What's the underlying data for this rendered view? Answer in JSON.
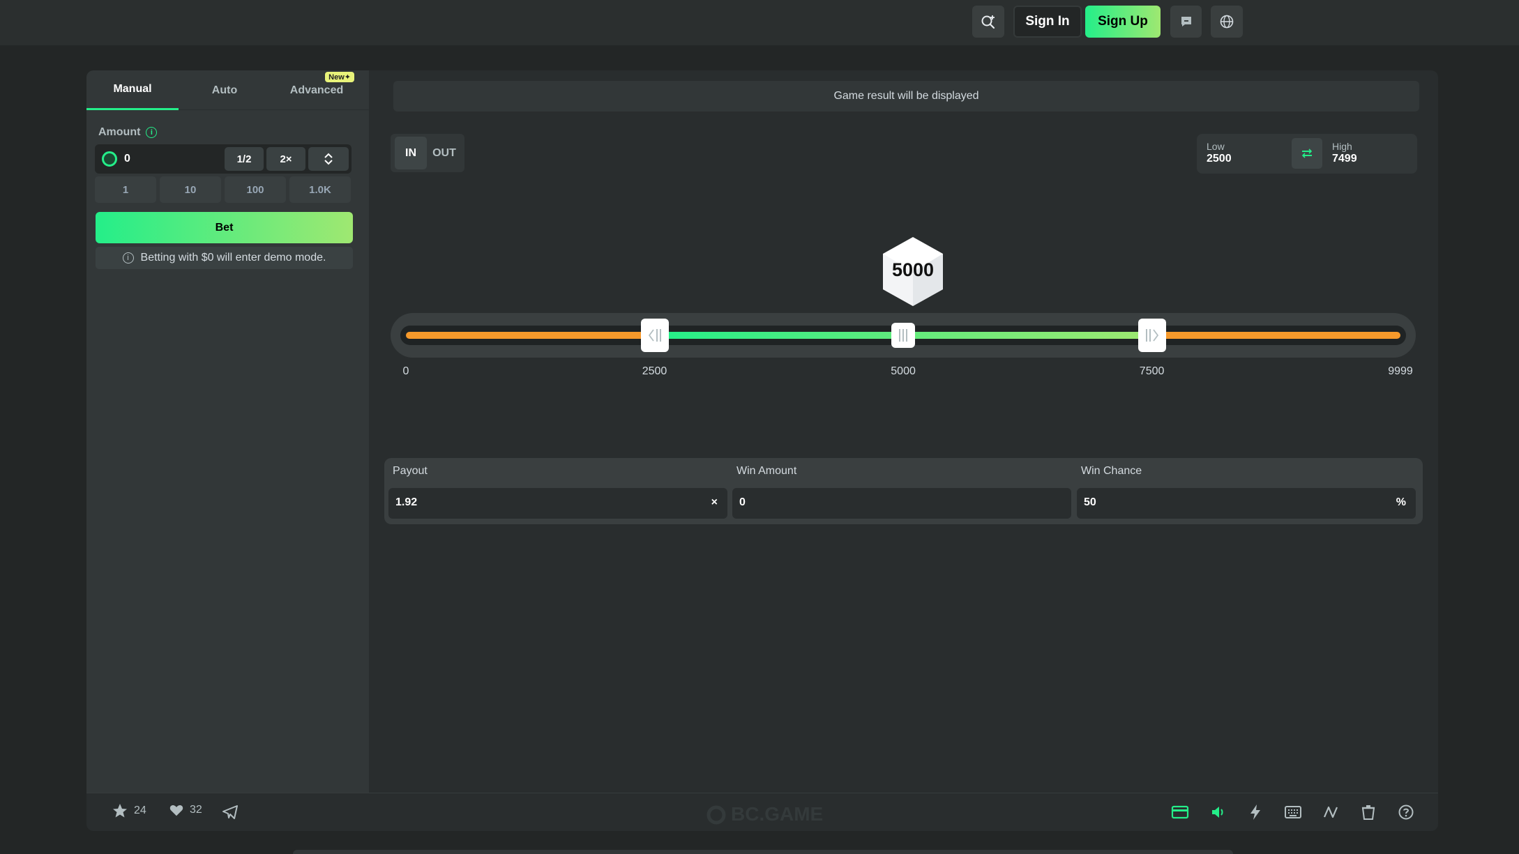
{
  "header": {
    "signin_label": "Sign In",
    "signup_label": "Sign Up"
  },
  "tabs": [
    {
      "label": "Manual",
      "active": true
    },
    {
      "label": "Auto",
      "active": false
    },
    {
      "label": "Advanced",
      "active": false,
      "badge": "New"
    }
  ],
  "bet_panel": {
    "amount_label": "Amount",
    "amount_value": "0",
    "half_label": "1/2",
    "double_label": "2×",
    "quick_amounts": [
      "1",
      "10",
      "100",
      "1.0K"
    ],
    "bet_label": "Bet",
    "demo_note": "Betting with $0 will enter demo mode."
  },
  "game": {
    "result_text": "Game result will be displayed",
    "mode_in": "IN",
    "mode_out": "OUT",
    "low_label": "Low",
    "low_value": "2500",
    "high_label": "High",
    "high_value": "7499",
    "dice_value": "5000",
    "range_min": 0,
    "range_max": 9999,
    "low": 2500,
    "high": 7500,
    "current": 5000,
    "ticks": [
      "0",
      "2500",
      "5000",
      "7500",
      "9999"
    ],
    "colors": {
      "in": "#24ee89",
      "out": "#f6992b"
    }
  },
  "stats": {
    "payout_label": "Payout",
    "payout_value": "1.92",
    "payout_suffix": "×",
    "win_amount_label": "Win Amount",
    "win_amount_value": "0",
    "win_chance_label": "Win Chance",
    "win_chance_value": "50",
    "win_chance_suffix": "%"
  },
  "footer": {
    "stars": "24",
    "likes": "32",
    "watermark": "BC.GAME"
  }
}
